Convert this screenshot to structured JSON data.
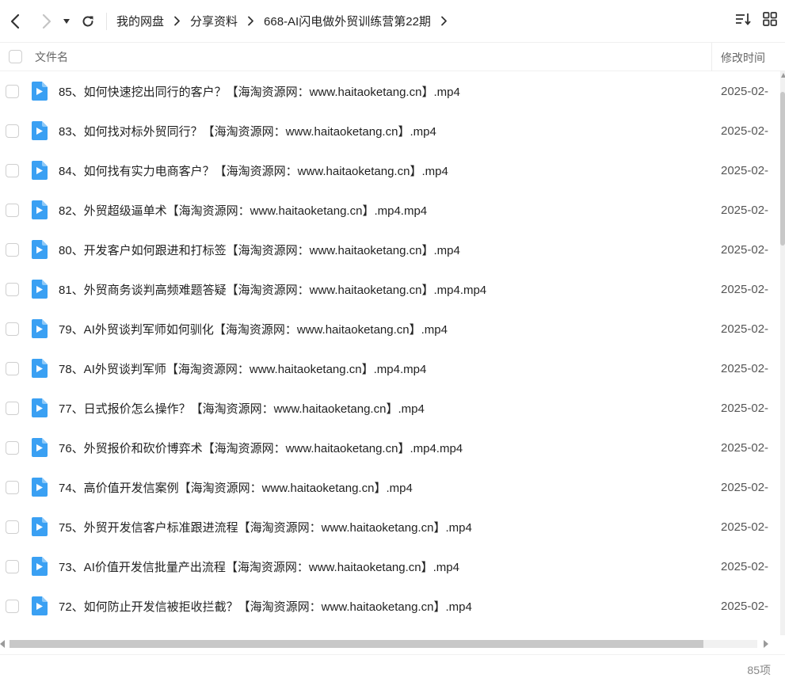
{
  "toolbar": {
    "back_icon": "chevron-left-icon",
    "forward_icon": "chevron-right-icon",
    "dropdown_icon": "caret-down-icon",
    "refresh_icon": "refresh-icon",
    "breadcrumb": [
      "我的网盘",
      "分享资料",
      "668-AI闪电做外贸训练营第22期"
    ],
    "sort_icon": "sort-icon",
    "view_icon": "grid-view-icon"
  },
  "header": {
    "name_label": "文件名",
    "time_label": "修改时间"
  },
  "files": [
    {
      "name": "85、如何快速挖出同行的客户？【海淘资源网：www.haitaoketang.cn】.mp4",
      "time": "2025-02-"
    },
    {
      "name": "83、如何找对标外贸同行？【海淘资源网：www.haitaoketang.cn】.mp4",
      "time": "2025-02-"
    },
    {
      "name": "84、如何找有实力电商客户？【海淘资源网：www.haitaoketang.cn】.mp4",
      "time": "2025-02-"
    },
    {
      "name": "82、外贸超级逼单术【海淘资源网：www.haitaoketang.cn】.mp4.mp4",
      "time": "2025-02-"
    },
    {
      "name": "80、开发客户如何跟进和打标签【海淘资源网：www.haitaoketang.cn】.mp4",
      "time": "2025-02-"
    },
    {
      "name": "81、外贸商务谈判高频难题答疑【海淘资源网：www.haitaoketang.cn】.mp4.mp4",
      "time": "2025-02-"
    },
    {
      "name": "79、AI外贸谈判军师如何驯化【海淘资源网：www.haitaoketang.cn】.mp4",
      "time": "2025-02-"
    },
    {
      "name": "78、AI外贸谈判军师【海淘资源网：www.haitaoketang.cn】.mp4.mp4",
      "time": "2025-02-"
    },
    {
      "name": "77、日式报价怎么操作？【海淘资源网：www.haitaoketang.cn】.mp4",
      "time": "2025-02-"
    },
    {
      "name": "76、外贸报价和砍价博弈术【海淘资源网：www.haitaoketang.cn】.mp4.mp4",
      "time": "2025-02-"
    },
    {
      "name": "74、高价值开发信案例【海淘资源网：www.haitaoketang.cn】.mp4",
      "time": "2025-02-"
    },
    {
      "name": "75、外贸开发信客户标准跟进流程【海淘资源网：www.haitaoketang.cn】.mp4",
      "time": "2025-02-"
    },
    {
      "name": "73、AI价值开发信批量产出流程【海淘资源网：www.haitaoketang.cn】.mp4",
      "time": "2025-02-"
    },
    {
      "name": "72、如何防止开发信被拒收拦截？【海淘资源网：www.haitaoketang.cn】.mp4",
      "time": "2025-02-"
    }
  ],
  "file_icon": "video-file-icon",
  "status": {
    "count": "85项"
  },
  "colors": {
    "accent": "#3aa0f3",
    "text": "#222222",
    "muted": "#888888"
  }
}
